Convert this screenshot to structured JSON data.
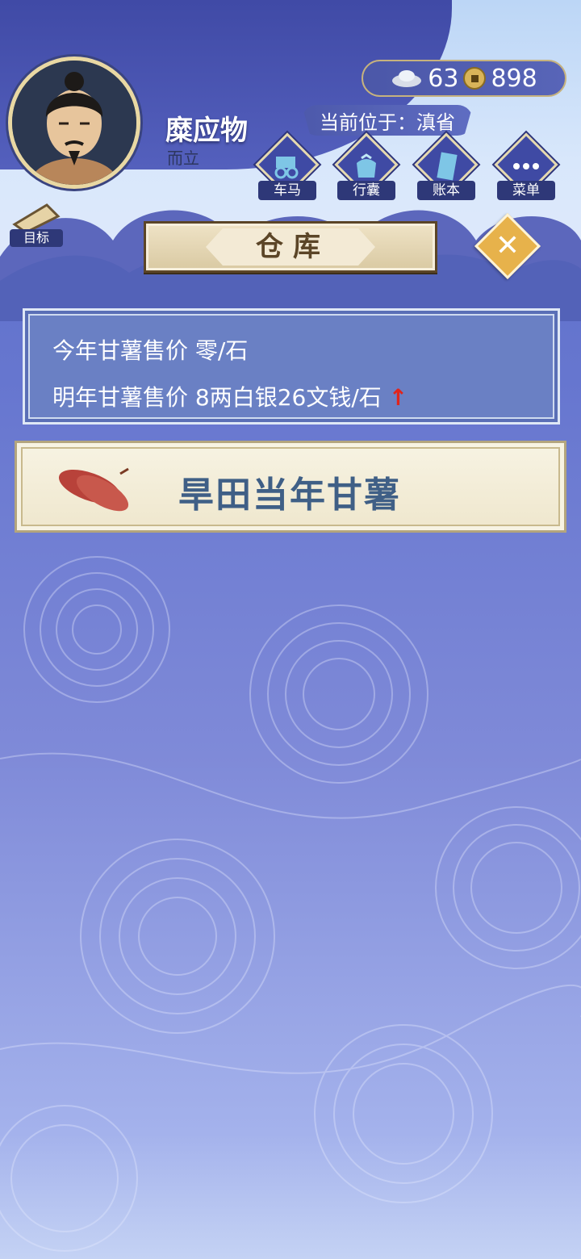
{
  "player": {
    "name": "糜应物",
    "title": "而立"
  },
  "currency": {
    "silver": "63",
    "coins": "898"
  },
  "location": {
    "text": "当前位于：滇省"
  },
  "nav": [
    {
      "label": "车马",
      "icon": "carriage-icon"
    },
    {
      "label": "行囊",
      "icon": "bag-icon"
    },
    {
      "label": "账本",
      "icon": "ledger-icon"
    },
    {
      "label": "菜单",
      "icon": "menu-icon"
    }
  ],
  "goal": {
    "label": "目标",
    "icon": "scroll-icon"
  },
  "dialog": {
    "title": "仓库",
    "close_icon": "close-icon"
  },
  "prices": {
    "this_year": "今年甘薯售价 零/石",
    "next_year": "明年甘薯售价 8两白银26文钱/石",
    "trend_icon": "up-arrow-icon",
    "trend_symbol": "↑",
    "trend_color": "#e1241b"
  },
  "items": [
    {
      "label": "旱田当年甘薯",
      "icon": "sweet-potato-icon"
    }
  ]
}
